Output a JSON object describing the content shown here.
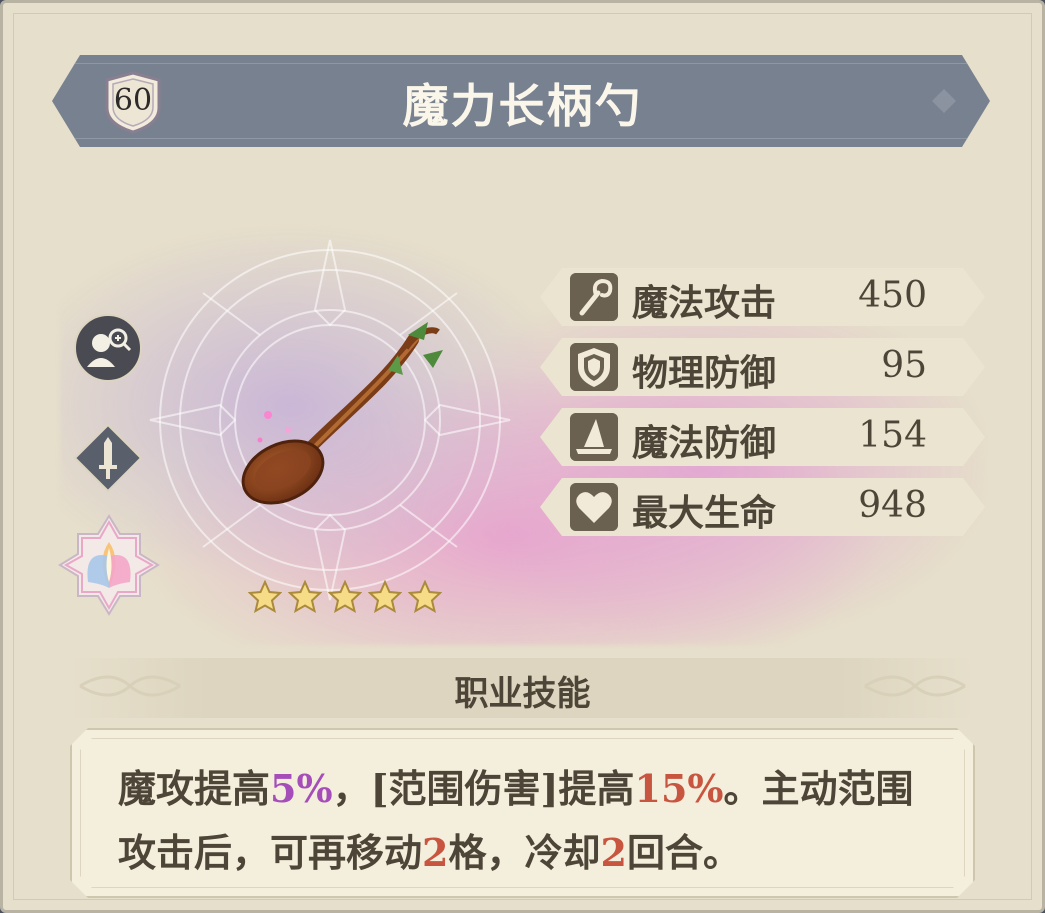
{
  "item": {
    "level": "60",
    "name": "魔力长柄勺",
    "stars": 5
  },
  "stats": [
    {
      "icon": "staff-icon",
      "label": "魔法攻击",
      "value": "450"
    },
    {
      "icon": "shield-icon",
      "label": "物理防御",
      "value": "95"
    },
    {
      "icon": "wizard-hat-icon",
      "label": "魔法防御",
      "value": "154"
    },
    {
      "icon": "heart-icon",
      "label": "最大生命",
      "value": "948"
    }
  ],
  "side_icons": [
    "character-inspect-icon",
    "sword-class-icon",
    "lotus-element-icon"
  ],
  "skill": {
    "header": "职业技能",
    "parts": [
      {
        "text": "魔攻提高",
        "style": "normal"
      },
      {
        "text": "5%",
        "style": "purple"
      },
      {
        "text": "，[范围伤害]提高",
        "style": "normal"
      },
      {
        "text": "15%",
        "style": "red"
      },
      {
        "text": "。主动范围攻击后，可再移动",
        "style": "normal"
      },
      {
        "text": "2",
        "style": "red"
      },
      {
        "text": "格，冷却",
        "style": "normal"
      },
      {
        "text": "2",
        "style": "red"
      },
      {
        "text": "回合。",
        "style": "normal"
      }
    ]
  },
  "colors": {
    "panel": "#e6dfcb",
    "title_bar": "#78818f",
    "text": "#4d4538",
    "highlight_purple": "#a54db8",
    "highlight_red": "#c8553f"
  }
}
